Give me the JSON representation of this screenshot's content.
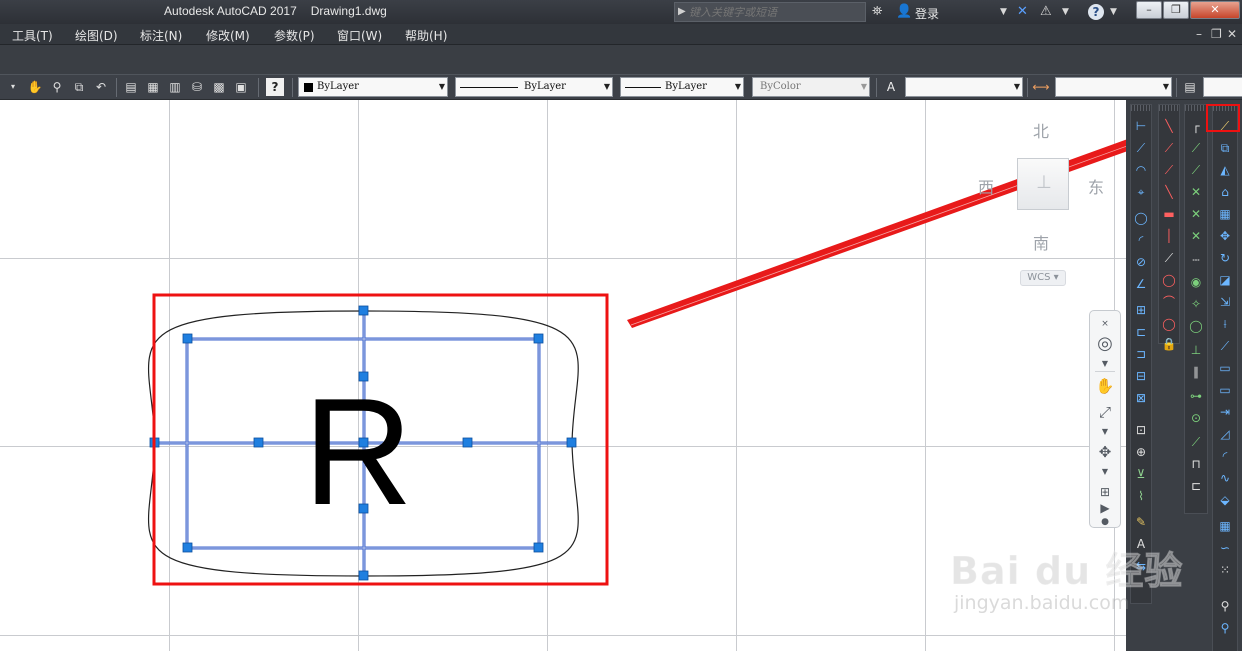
{
  "title_bar": {
    "app_title": "Autodesk AutoCAD 2017",
    "file_name": "Drawing1.dwg",
    "search_placeholder": "键入关键字或短语",
    "login_label": "登录"
  },
  "menu": {
    "items": [
      "工具(T)",
      "绘图(D)",
      "标注(N)",
      "修改(M)",
      "参数(P)",
      "窗口(W)",
      "帮助(H)"
    ]
  },
  "properties_toolbar": {
    "color_combo": "ByLayer",
    "linetype_combo": "ByLayer",
    "lineweight_combo": "ByLayer",
    "plotstyle_combo": "ByColor"
  },
  "drawing": {
    "text_object": "R"
  },
  "viewcube": {
    "north": "北",
    "south": "南",
    "east": "东",
    "west": "西",
    "wcs_label": "WCS"
  },
  "watermark": {
    "brand": "Bai du 经验",
    "url": "jingyan.baidu.com"
  },
  "colors": {
    "grips": "#1f7fe0",
    "highlight": "#ee1111",
    "arrow": "#ee1111",
    "selection_lines": "#2a55c8"
  }
}
